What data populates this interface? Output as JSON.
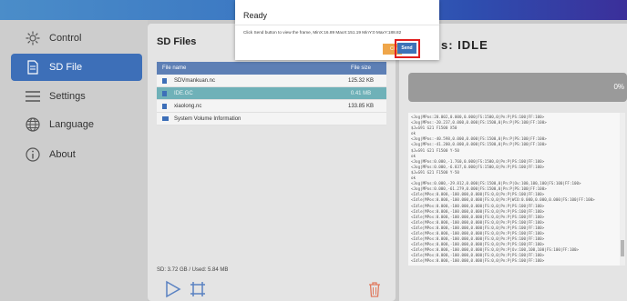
{
  "sidebar": {
    "items": [
      {
        "label": "Control",
        "icon": "gear-icon"
      },
      {
        "label": "SD File",
        "icon": "file-icon"
      },
      {
        "label": "Settings",
        "icon": "menu-icon"
      },
      {
        "label": "Language",
        "icon": "globe-icon"
      },
      {
        "label": "About",
        "icon": "info-icon"
      }
    ]
  },
  "files": {
    "title": "SD Files",
    "headers": {
      "name": "File name",
      "size": "File size"
    },
    "rows": [
      {
        "name": "SDVmankuan.nc",
        "size": "125.32 KB",
        "type": "file"
      },
      {
        "name": "IDE.GC",
        "size": "0.41 MB",
        "type": "file"
      },
      {
        "name": "xiaolong.nc",
        "size": "133.85 KB",
        "type": "file"
      },
      {
        "name": "System Volume Information",
        "size": "",
        "type": "folder"
      }
    ],
    "sd_info": "SD: 3.72 GB  /  Used: 5.84 MB"
  },
  "status": {
    "title": "s: IDLE",
    "progress": "0%",
    "log": "<Jog|MPos:20.002,0.000,0.000|FS:1500,0|Pn:P|PS:100|FF:100>\n<Jog|MPos:-20.237,0.000,0.000|FS:1500,0|Pn:P|PS:100|FF:100>\n$J=G91 G21 F1500 X50\nok\n<Jog|MPos:-40.598,0.000,0.000|FS:1500,0|Pn:P|PS:100|FF:100>\n<Jog|MPos:-41.200,0.000,0.000|FS:1500,0|Pn:P|PS:100|FF:100>\n$J=G91 G21 F1500 Y-50\nok\n<Jog|MPos:0.000,-1.760,0.000|FS:1500,0|Pn:P|PS:100|FF:100>\n<Jog|MPos:0.000,-6.837,0.000|FS:1500,0|Pn:P|PS:100|FF:100>\n$J=G91 G21 F1500 Y-50\nok\n<Jog|MPos:0.000,-29.812,0.000|FS:1500,0|Pn:P|Ov:100,100,100|FS:100|FF:100>\n<Jog|MPos:0.000,-61.279,0.000|FS:1500,0|Pn:P|PS:100|FF:100>\n<Idle|MPos:0.000,-100.000,0.000|FS:0,0|Pn:P|PS:100|FF:100>\n<Idle|MPos:0.000,-100.000,0.000|FS:0,0|Pn:P|WCO:0.000,0.000,0.000|FS:100|FF:100>\n<Idle|MPos:0.000,-100.000,0.000|FS:0,0|Pn:P|PS:100|FF:100>\n<Idle|MPos:0.000,-100.000,0.000|FS:0,0|Pn:P|PS:100|FF:100>\n<Idle|MPos:0.000,-100.000,0.000|FS:0,0|Pn:P|PS:100|FF:100>\n<Idle|MPos:0.000,-100.000,0.000|FS:0,0|Pn:P|PS:100|FF:100>\n<Idle|MPos:0.000,-100.000,0.000|FS:0,0|Pn:P|PS:100|FF:100>\n<Idle|MPos:0.000,-100.000,0.000|FS:0,0|Pn:P|PS:100|FF:100>\n<Idle|MPos:0.000,-100.000,0.000|FS:0,0|Pn:P|PS:100|FF:100>\n<Idle|MPos:0.000,-100.000,0.000|FS:0,0|Pn:P|PS:100|FF:100>\n<Idle|MPos:0.000,-100.000,0.000|FS:0,0|Pn:P|Ov:100,100,100|FS:100|FF:100>\n<Idle|MPos:0.000,-100.000,0.000|FS:0,0|Pn:P|PS:100|FF:100>\n<Idle|MPos:0.000,-100.000,0.000|FS:0,0|Pn:P|PS:100|FF:100>"
  },
  "modal": {
    "title": "Ready",
    "message": "Click Send button to view the frame, MinX:16.89 MaxX:151.19 MinY:0 MaxY:188.82",
    "close_label": "Clos",
    "send_label": "Send"
  },
  "colors": {
    "accent": "#3d6fb8",
    "highlight": "#e02020",
    "close": "#efa64a",
    "selected_row": "#6fb1b8"
  }
}
